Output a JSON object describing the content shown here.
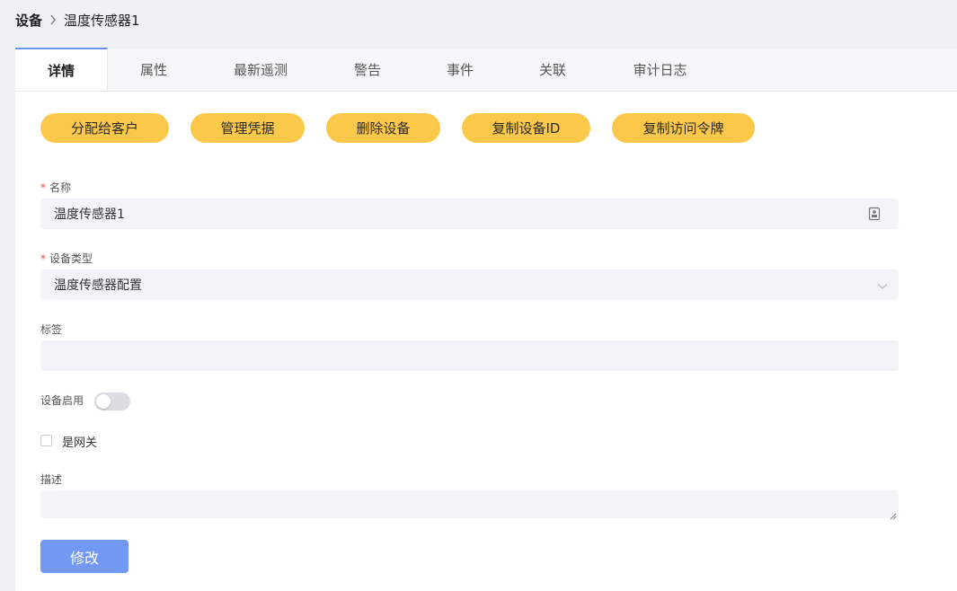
{
  "breadcrumb": {
    "root": "设备",
    "current": "温度传感器1"
  },
  "tabs": [
    {
      "label": "详情",
      "active": true
    },
    {
      "label": "属性",
      "active": false
    },
    {
      "label": "最新遥测",
      "active": false
    },
    {
      "label": "警告",
      "active": false
    },
    {
      "label": "事件",
      "active": false
    },
    {
      "label": "关联",
      "active": false
    },
    {
      "label": "审计日志",
      "active": false
    }
  ],
  "actions": {
    "assign_customer": "分配给客户",
    "manage_credentials": "管理凭据",
    "delete_device": "删除设备",
    "copy_device_id": "复制设备ID",
    "copy_access_token": "复制访问令牌"
  },
  "form": {
    "name_label": "名称",
    "name_value": "温度传感器1",
    "type_label": "设备类型",
    "type_value": "温度传感器配置",
    "tag_label": "标签",
    "tag_value": "",
    "enabled_label": "设备启用",
    "enabled": false,
    "gateway_label": "是网关",
    "gateway": false,
    "description_label": "描述",
    "description_value": "",
    "required_mark": "*",
    "submit_label": "修改"
  },
  "colors": {
    "action_button": "#fbc84a",
    "primary": "#7198f3",
    "tab_indicator": "#6b93f0",
    "required": "#e5483b",
    "page_bg": "#f0f1f5"
  },
  "icons": {
    "breadcrumb_separator": "chevron-right-icon",
    "name_field": "id-card-icon",
    "type_dropdown": "chevron-down-icon"
  }
}
